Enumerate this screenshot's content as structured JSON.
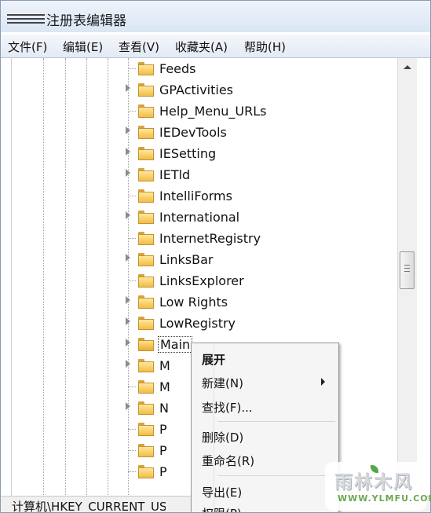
{
  "window": {
    "title": "注册表编辑器"
  },
  "menu": [
    {
      "id": "file",
      "label": "文件(F)"
    },
    {
      "id": "edit",
      "label": "编辑(E)"
    },
    {
      "id": "view",
      "label": "查看(V)"
    },
    {
      "id": "favorites",
      "label": "收藏夹(A)"
    },
    {
      "id": "help",
      "label": "帮助(H)"
    }
  ],
  "tree": {
    "items": [
      {
        "label": "Feeds",
        "expandable": false
      },
      {
        "label": "GPActivities",
        "expandable": true
      },
      {
        "label": "Help_Menu_URLs",
        "expandable": false
      },
      {
        "label": "IEDevTools",
        "expandable": true
      },
      {
        "label": "IESetting",
        "expandable": true
      },
      {
        "label": "IETld",
        "expandable": true
      },
      {
        "label": "IntelliForms",
        "expandable": false
      },
      {
        "label": "International",
        "expandable": true
      },
      {
        "label": "InternetRegistry",
        "expandable": false
      },
      {
        "label": "LinksBar",
        "expandable": true
      },
      {
        "label": "LinksExplorer",
        "expandable": false
      },
      {
        "label": "Low Rights",
        "expandable": true
      },
      {
        "label": "LowRegistry",
        "expandable": true
      },
      {
        "label": "Main",
        "expandable": true,
        "selected": true
      },
      {
        "label": "M",
        "expandable": true
      },
      {
        "label": "M",
        "expandable": false
      },
      {
        "label": "N",
        "expandable": true
      },
      {
        "label": "P",
        "expandable": false
      },
      {
        "label": "P",
        "expandable": false
      },
      {
        "label": "P",
        "expandable": false
      }
    ]
  },
  "context_menu": {
    "items": [
      {
        "label": "展开",
        "bold": true
      },
      {
        "label": "新建(N)",
        "submenu": true
      },
      {
        "label": "查找(F)..."
      },
      {
        "label": "删除(D)"
      },
      {
        "label": "重命名(R)"
      },
      {
        "label": "导出(E)"
      },
      {
        "label": "权限(P)..."
      }
    ]
  },
  "status_bar": {
    "path": "计算机\\HKEY_CURRENT_USER\\Software\\Microsoft\\Internet Explorer\\Main"
  },
  "watermark": {
    "text": "雨林木风",
    "url": "WWW.YLMFU.COM"
  },
  "colors": {
    "folder": "#f1bd46",
    "menubar": "#e3eaf4",
    "border": "#8a9bb0"
  }
}
